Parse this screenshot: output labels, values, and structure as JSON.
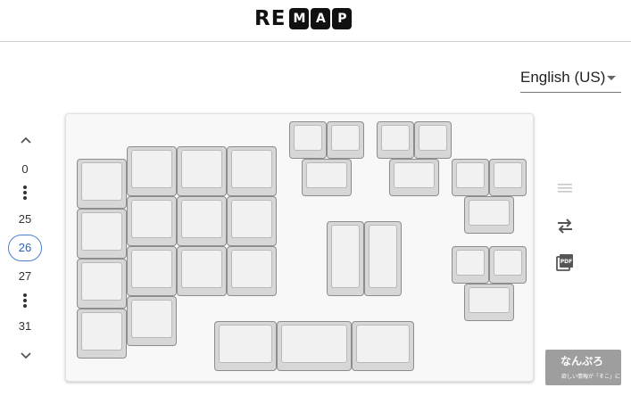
{
  "header": {
    "logo_plain": "RE",
    "logo_boxed": [
      "M",
      "A",
      "P"
    ]
  },
  "language": {
    "selected": "English (US)"
  },
  "layers": {
    "up_icon": "chevron-up-icon",
    "down_icon": "chevron-down-icon",
    "items": [
      {
        "label": "0",
        "active": false
      },
      {
        "label": "25",
        "active": false
      },
      {
        "label": "26",
        "active": true
      },
      {
        "label": "27",
        "active": false
      },
      {
        "label": "31",
        "active": false
      }
    ],
    "accent_color": "#4a7fd1"
  },
  "tools": [
    {
      "icon": "keymap-list-icon"
    },
    {
      "icon": "swap-icon"
    },
    {
      "icon": "pdf-icon"
    }
  ],
  "watermark": {
    "title": "なんぷろ",
    "subtitle": "欲しい情報が「そこ」に"
  },
  "colors": {
    "key_face": "#f1f1f1",
    "key_side": "#d7d7d7",
    "board_bg": "#f8f8f8"
  }
}
